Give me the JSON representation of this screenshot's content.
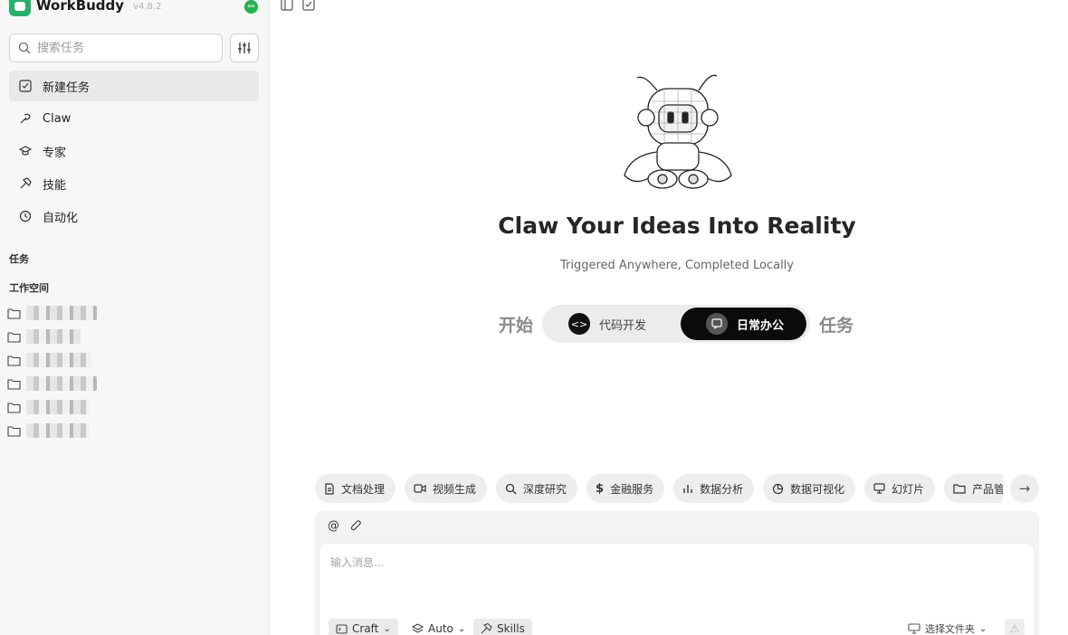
{
  "brand": {
    "name": "WorkBuddy",
    "version": "v4.8.2"
  },
  "search": {
    "placeholder": "搜索任务"
  },
  "nav": [
    {
      "label": "新建任务",
      "icon": "new-task-icon"
    },
    {
      "label": "Claw",
      "icon": "claw-icon"
    },
    {
      "label": "专家",
      "icon": "graduation-cap-icon"
    },
    {
      "label": "技能",
      "icon": "hammer-icon"
    },
    {
      "label": "自动化",
      "icon": "clock-icon"
    }
  ],
  "sections": {
    "tasks": "任务",
    "workspace": "工作空间"
  },
  "workspaces": [
    "",
    "",
    "",
    "",
    "",
    ""
  ],
  "hero": {
    "title": "Claw Your Ideas Into Reality",
    "subtitle": "Triggered Anywhere, Completed Locally"
  },
  "mode": {
    "prefix": "开始",
    "suffix": "任务",
    "options": [
      {
        "label": "代码开发",
        "selected": false
      },
      {
        "label": "日常办公",
        "selected": true
      }
    ]
  },
  "chips": [
    {
      "label": "文档处理",
      "icon": "document-icon"
    },
    {
      "label": "视频生成",
      "icon": "video-icon"
    },
    {
      "label": "深度研究",
      "icon": "search-icon"
    },
    {
      "label": "金融服务",
      "icon": "dollar-icon"
    },
    {
      "label": "数据分析",
      "icon": "bar-chart-icon"
    },
    {
      "label": "数据可视化",
      "icon": "pie-chart-icon"
    },
    {
      "label": "幻灯片",
      "icon": "monitor-icon"
    },
    {
      "label": "产品管",
      "icon": "folder-icon"
    }
  ],
  "composer": {
    "placeholder": "输入消息...",
    "mode": "Craft",
    "model": "Auto",
    "skills": "Skills",
    "folder": "选择文件夹"
  },
  "colors": {
    "accent": "#0b0b0b",
    "badge": "#22b14c",
    "sidebar_bg": "#f7f7f7"
  }
}
